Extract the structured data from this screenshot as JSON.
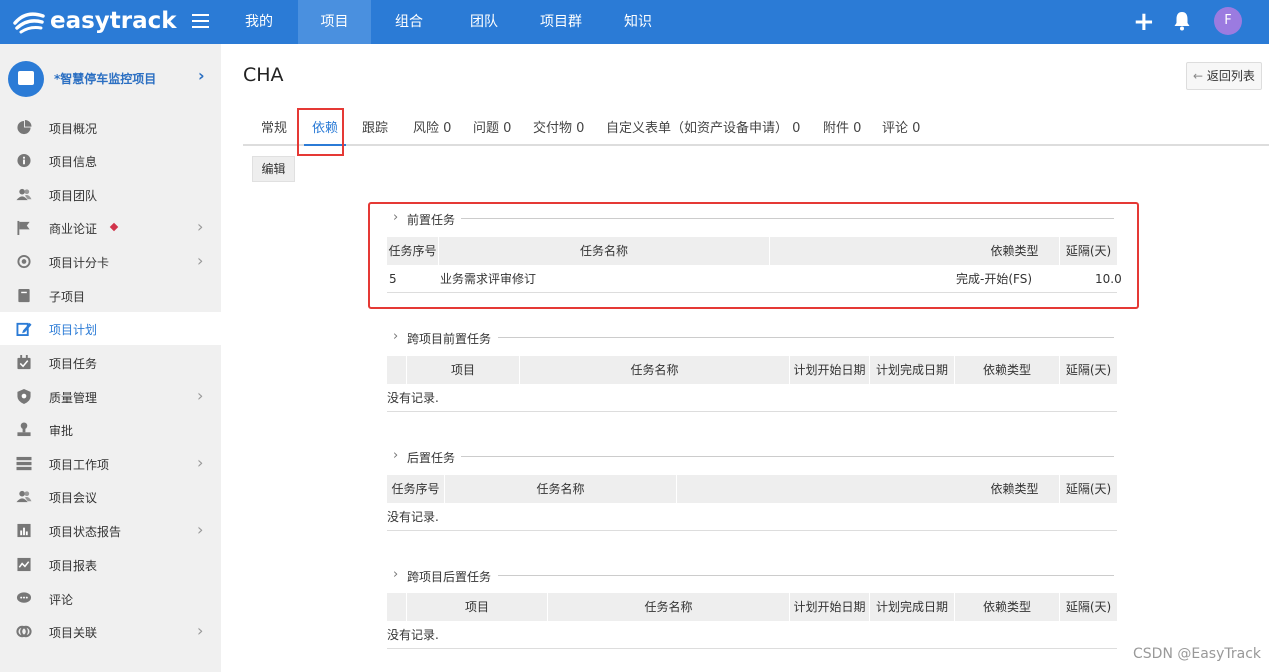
{
  "app": {
    "name": "easytrack"
  },
  "topnav": {
    "items": [
      "我的",
      "项目",
      "组合",
      "团队",
      "项目群",
      "知识"
    ],
    "active": "项目",
    "avatar_letter": "F"
  },
  "sidebar": {
    "project_name": "*智慧停车监控项目",
    "items": [
      {
        "label": "项目概况",
        "icon": "pie-chart-icon",
        "chevron": false
      },
      {
        "label": "项目信息",
        "icon": "info-icon",
        "chevron": false
      },
      {
        "label": "项目团队",
        "icon": "team-icon",
        "chevron": false
      },
      {
        "label": "商业论证",
        "icon": "flag-icon",
        "chevron": true
      },
      {
        "label": "项目计分卡",
        "icon": "target-icon",
        "chevron": true
      },
      {
        "label": "子项目",
        "icon": "book-icon",
        "chevron": false
      },
      {
        "label": "项目计划",
        "icon": "edit-icon",
        "chevron": false
      },
      {
        "label": "项目任务",
        "icon": "calendar-icon",
        "chevron": false
      },
      {
        "label": "质量管理",
        "icon": "shield-icon",
        "chevron": true
      },
      {
        "label": "审批",
        "icon": "stamp-icon",
        "chevron": false
      },
      {
        "label": "项目工作项",
        "icon": "list-icon",
        "chevron": true
      },
      {
        "label": "项目会议",
        "icon": "meeting-icon",
        "chevron": false
      },
      {
        "label": "项目状态报告",
        "icon": "bar-chart-icon",
        "chevron": true
      },
      {
        "label": "项目报表",
        "icon": "line-chart-icon",
        "chevron": false
      },
      {
        "label": "评论",
        "icon": "comment-icon",
        "chevron": false
      },
      {
        "label": "项目关联",
        "icon": "link-icon",
        "chevron": true
      }
    ],
    "active": "项目计划"
  },
  "main": {
    "title": "CHA",
    "back_label": "返回列表",
    "tabs": [
      {
        "label": "常规"
      },
      {
        "label": "依赖"
      },
      {
        "label": "跟踪"
      },
      {
        "label": "风险 0"
      },
      {
        "label": "问题 0"
      },
      {
        "label": "交付物 0"
      },
      {
        "label": "自定义表单（如资产设备申请） 0"
      },
      {
        "label": "附件 0"
      },
      {
        "label": "评论 0"
      }
    ],
    "active_tab": "依赖",
    "edit_label": "编辑"
  },
  "sections": {
    "predecessor": {
      "title": "前置任务",
      "columns": [
        "任务序号",
        "任务名称",
        "依赖类型",
        "延隔(天)"
      ],
      "rows": [
        {
          "seq": "5",
          "name": "业务需求评审修订",
          "type": "完成-开始(FS)",
          "lag": "10.0"
        }
      ]
    },
    "cross_predecessor": {
      "title": "跨项目前置任务",
      "columns": [
        "项目",
        "任务名称",
        "计划开始日期",
        "计划完成日期",
        "依赖类型",
        "延隔(天)"
      ],
      "empty": "没有记录."
    },
    "successor": {
      "title": "后置任务",
      "columns": [
        "任务序号",
        "任务名称",
        "依赖类型",
        "延隔(天)"
      ],
      "empty": "没有记录."
    },
    "cross_successor": {
      "title": "跨项目后置任务",
      "columns": [
        "项目",
        "任务名称",
        "计划开始日期",
        "计划完成日期",
        "依赖类型",
        "延隔(天)"
      ],
      "empty": "没有记录."
    }
  },
  "watermark": "CSDN @EasyTrack",
  "colors": {
    "primary": "#2b7bd6",
    "highlight": "#e53935",
    "avatar": "#9b7be0"
  }
}
